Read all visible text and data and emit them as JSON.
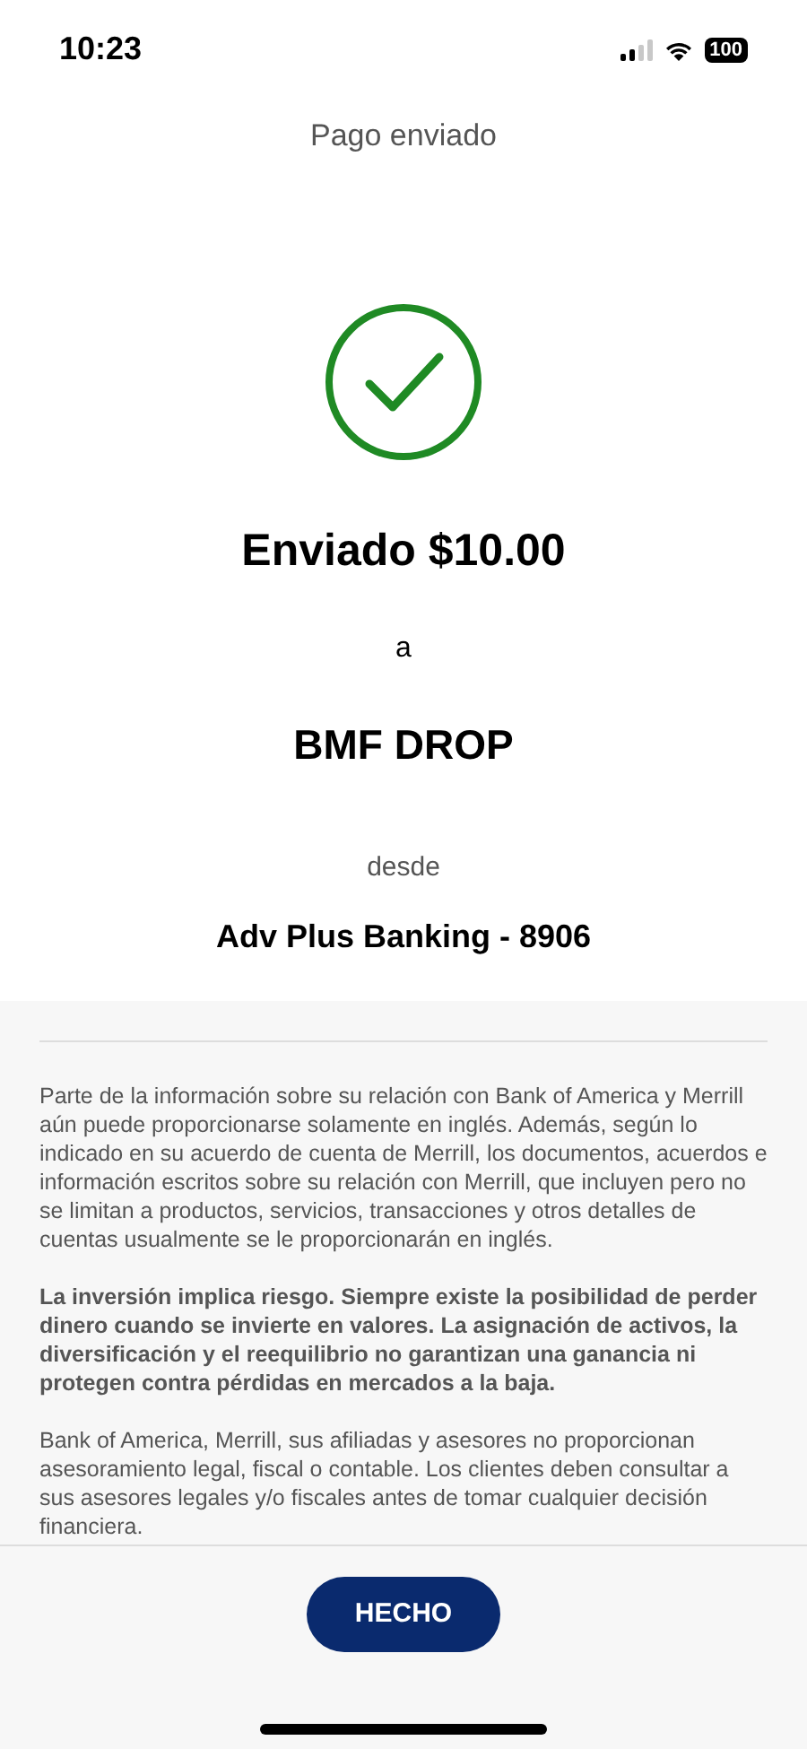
{
  "status_bar": {
    "time": "10:23",
    "battery": "100"
  },
  "header": {
    "title": "Pago enviado"
  },
  "confirmation": {
    "headline": "Enviado $10.00",
    "to_label": "a",
    "recipient": "BMF DROP",
    "from_label": "desde",
    "account": "Adv Plus Banking - 8906"
  },
  "disclosures": [
    {
      "kind": "normal",
      "text": "Parte de la información sobre su relación con Bank of America y Merrill aún puede proporcionarse solamente en inglés. Además, según lo indicado en su acuerdo de cuenta de Merrill, los documentos, acuerdos e información escritos sobre su relación con Merrill, que incluyen pero no se limitan a productos, servicios, transacciones y otros detalles de cuentas usualmente se le proporcionarán en inglés."
    },
    {
      "kind": "bold",
      "text": "La inversión implica riesgo. Siempre existe la posibilidad de perder dinero cuando se invierte en valores. La asignación de activos, la diversificación y el reequilibrio no garantizan una ganancia ni protegen contra pérdidas en mercados a la baja."
    },
    {
      "kind": "normal",
      "text": "Bank of America, Merrill, sus afiliadas y asesores no proporcionan asesoramiento legal, fiscal o contable. Los clientes deben consultar a sus asesores legales y/o fiscales antes de tomar cualquier decisión financiera."
    }
  ],
  "done_button": {
    "label": "HECHO"
  }
}
